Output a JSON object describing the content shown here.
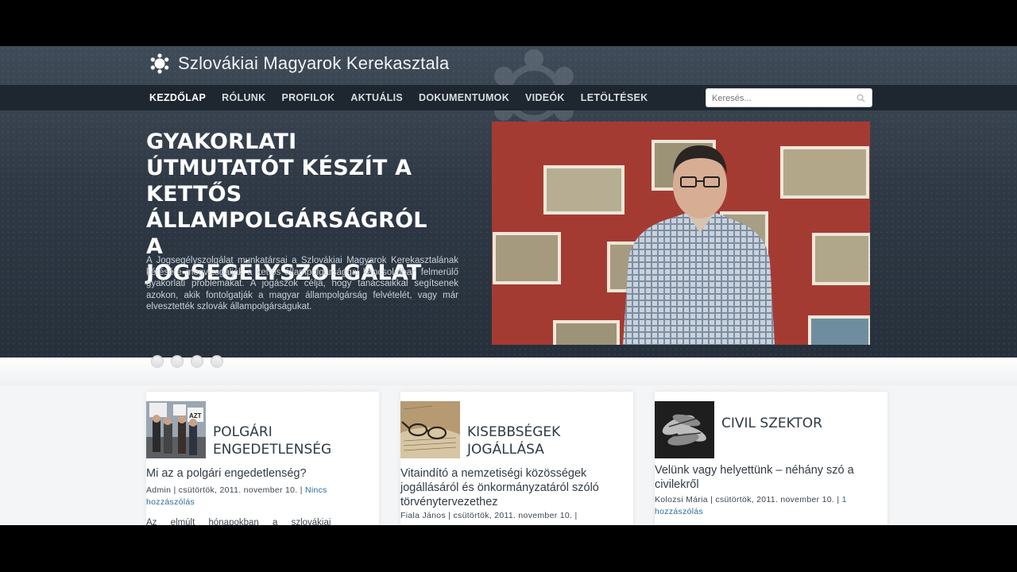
{
  "site": {
    "title": "Szlovákiai Magyarok Kerekasztala"
  },
  "nav": {
    "items": [
      {
        "label": "KEZDŐLAP",
        "active": true
      },
      {
        "label": "RÓLUNK"
      },
      {
        "label": "PROFILOK"
      },
      {
        "label": "AKTUÁLIS"
      },
      {
        "label": "DOKUMENTUMOK"
      },
      {
        "label": "VIDEÓK"
      },
      {
        "label": "LETÖLTÉSEK"
      }
    ],
    "search_placeholder": "Keresés..."
  },
  "hero": {
    "title": "GYAKORLATI ÚTMUTATÓT KÉSZÍT A KETTŐS ÁLLAMPOLGÁRSÁGRÓL A JOGSEGÉLYSZOLGÁLAT",
    "text": "A Jogsegélyszolgálat munkatársai a Szlovákiai Magyarok Kerekasztalának kérésére megvizsgálják a kettős állampolgársággal kapcsolatban felmerülő gyakorlati problémákat. A jogászok célja, hogy tanácsaikkal segítsenek azokon, akik fontolgatják a magyar állampolgárság felvételét, vagy már elvesztették szlovák állampolgárságukat.",
    "slides": 4
  },
  "cards": [
    {
      "heading": "POLGÁRI ENGEDETLENSÉG",
      "link": "Mi az a polgári engedetlenség?",
      "author": "Admin",
      "date": "csütörtök, 2011. november 10.",
      "comments": "Nincs hozzászólás",
      "excerpt": "Az elmúlt hónapokban a szlovákiai"
    },
    {
      "heading": "KISEBBSÉGEK JOGÁLLÁSA",
      "link": "Vitaindító a nemzetiségi közösségek jogállásáról és önkormányzatáról szóló törvénytervezethez",
      "author": "Fiala János",
      "date": "csütörtök, 2011. november 10.",
      "comments": ""
    },
    {
      "heading": "CIVIL SZEKTOR",
      "link": "Velünk vagy helyettünk – néhány szó a civilekről",
      "author": "Kolozsi Mária",
      "date": "csütörtök, 2011. november 10.",
      "comments": "1 hozzászólás"
    }
  ],
  "colors": {
    "header_bg": "#2f3945",
    "nav_bg": "#1e262f",
    "link": "#2a6a9a",
    "hero_image_wall": "#a43b33"
  }
}
